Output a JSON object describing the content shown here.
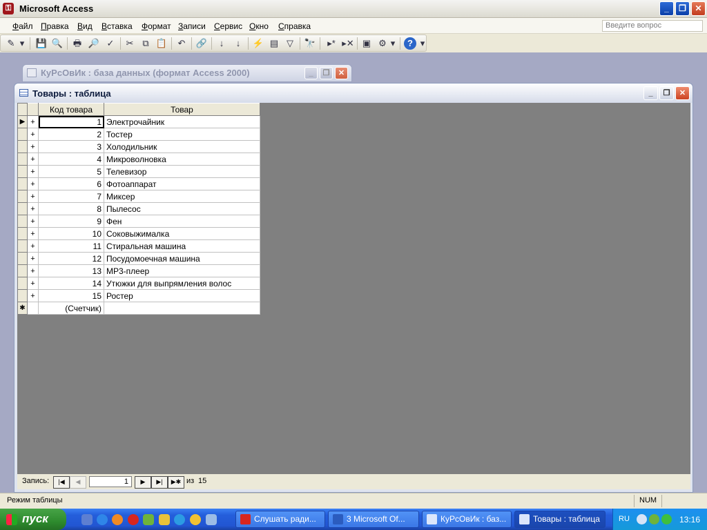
{
  "app": {
    "title": "Microsoft Access",
    "icon": "access-key-icon"
  },
  "window_controls": {
    "minimize": "_",
    "maximize": "❐",
    "close": "✕"
  },
  "menu": {
    "items": [
      {
        "hot": "Ф",
        "rest": "айл"
      },
      {
        "hot": "П",
        "rest": "равка"
      },
      {
        "hot": "В",
        "rest": "ид"
      },
      {
        "hot": "В",
        "rest": "ставка"
      },
      {
        "hot": "Ф",
        "rest": "ормат"
      },
      {
        "hot": "З",
        "rest": "аписи"
      },
      {
        "hot": "С",
        "rest": "ервис"
      },
      {
        "hot": "О",
        "rest": "кно"
      },
      {
        "hot": "С",
        "rest": "правка"
      }
    ],
    "ask_placeholder": "Введите вопрос"
  },
  "toolbar": {
    "icons": [
      "design-view-icon",
      "dropdown-arrow-icon",
      "save-icon",
      "search-file-icon",
      "print-icon",
      "print-preview-icon",
      "spelling-icon",
      "cut-icon",
      "copy-icon",
      "paste-icon",
      "undo-icon",
      "hyperlink-icon",
      "sort-ascending-icon",
      "sort-descending-icon",
      "filter-by-selection-icon",
      "filter-by-form-icon",
      "apply-filter-icon",
      "find-icon",
      "new-record-icon",
      "delete-record-icon",
      "database-window-icon",
      "new-object-icon",
      "dropdown-arrow-icon",
      "help-icon",
      "toolbar-options-icon"
    ],
    "glyphs": [
      "✎",
      "▾",
      "💾",
      "🔍",
      "🖶",
      "🔎",
      "✓",
      "✂",
      "⧉",
      "📋",
      "↶",
      "🔗",
      "↓",
      "↓",
      "⚡",
      "▤",
      "▽",
      "🔭",
      "▸*",
      "▸✕",
      "▣",
      "⚙",
      "▾",
      "?",
      "▾"
    ]
  },
  "db_window": {
    "title": "КуРсОвИк : база данных (формат Access 2000)"
  },
  "table_window": {
    "title": "Товары : таблица",
    "columns": [
      "Код товара",
      "Товар"
    ],
    "rows": [
      {
        "code": "1",
        "name": "Электрочайник"
      },
      {
        "code": "2",
        "name": "Тостер"
      },
      {
        "code": "3",
        "name": "Холодильник"
      },
      {
        "code": "4",
        "name": "Микроволновка"
      },
      {
        "code": "5",
        "name": "Телевизор"
      },
      {
        "code": "6",
        "name": "Фотоаппарат"
      },
      {
        "code": "7",
        "name": "Миксер"
      },
      {
        "code": "8",
        "name": "Пылесос"
      },
      {
        "code": "9",
        "name": "Фен"
      },
      {
        "code": "10",
        "name": "Соковыжималка"
      },
      {
        "code": "11",
        "name": "Стиральная машина"
      },
      {
        "code": "12",
        "name": "Посудомоечная машина"
      },
      {
        "code": "13",
        "name": "MP3-плеер"
      },
      {
        "code": "14",
        "name": "Утюжки для выпрямления волос"
      },
      {
        "code": "15",
        "name": "Ростер"
      }
    ],
    "new_row": {
      "code": "(Счетчик)",
      "name": ""
    },
    "current_row_marker": "▶",
    "new_row_marker": "✱",
    "expand_marker": "+",
    "nav": {
      "label": "Запись:",
      "current": "1",
      "of": "из",
      "total": "15",
      "first": "|◀",
      "prev": "◀",
      "next": "▶",
      "last": "▶|",
      "new": "▶✱"
    }
  },
  "status": {
    "mode": "Режим таблицы",
    "num": "NUM"
  },
  "taskbar": {
    "start": "пуск",
    "tasks": [
      "Слушать ради...",
      "3 Microsoft Of...",
      "КуРсОвИк : баз...",
      "Товары : таблица"
    ],
    "lang": "RU",
    "clock": "13:16"
  }
}
